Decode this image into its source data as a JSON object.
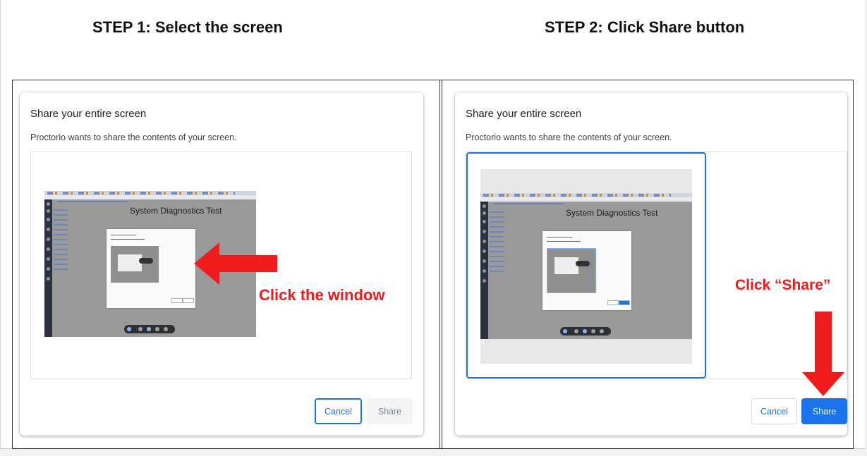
{
  "steps": {
    "step1_title": "STEP 1: Select the screen",
    "step2_title": "STEP 2: Click Share button"
  },
  "dialog": {
    "title": "Share your entire screen",
    "description": "Proctorio wants to share the contents of your screen.",
    "cancel_label": "Cancel",
    "share_label": "Share"
  },
  "thumbnail": {
    "page_title": "System Diagnostics Test"
  },
  "annotations": {
    "left": "Click the window",
    "right": "Click “Share”"
  },
  "colors": {
    "annotation_red": "#ee1c1c",
    "accent_blue": "#1a73e8"
  }
}
